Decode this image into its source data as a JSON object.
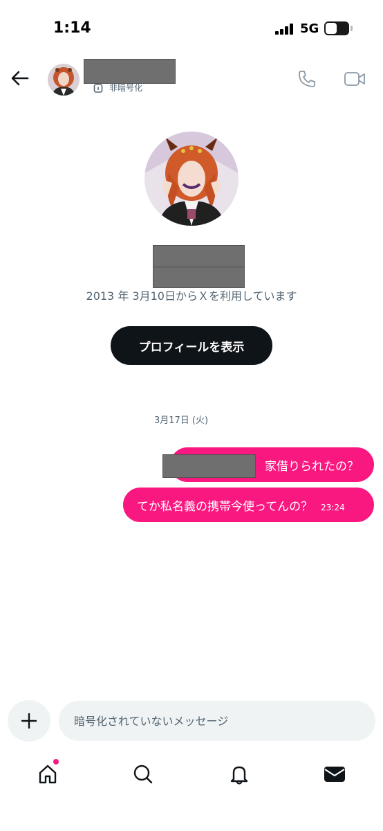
{
  "status_bar": {
    "time": "1:14",
    "network": "5G",
    "battery": "50",
    "battery_level": 0.5
  },
  "header": {
    "encryption_label": "非暗号化"
  },
  "profile": {
    "joined_text": "2013 年 3月10日からＸを利用しています",
    "view_profile_label": "プロフィールを表示"
  },
  "conversation": {
    "date": "3月17日 (火)",
    "messages": [
      {
        "text": "家借りられたの？",
        "time": ""
      },
      {
        "text": "てか私名義の携帯今使ってんの？",
        "time": "23:24"
      }
    ]
  },
  "composer": {
    "placeholder": "暗号化されていないメッセージ"
  },
  "nav": {
    "items": [
      {
        "icon": "home-icon",
        "badge": true
      },
      {
        "icon": "search-icon",
        "badge": false
      },
      {
        "icon": "bell-icon",
        "badge": false
      },
      {
        "icon": "mail-icon",
        "badge": false
      }
    ]
  },
  "colors": {
    "accent": "#f91880",
    "button_dark": "#0f1419",
    "muted_text": "#536471",
    "input_bg": "#eff3f4"
  }
}
